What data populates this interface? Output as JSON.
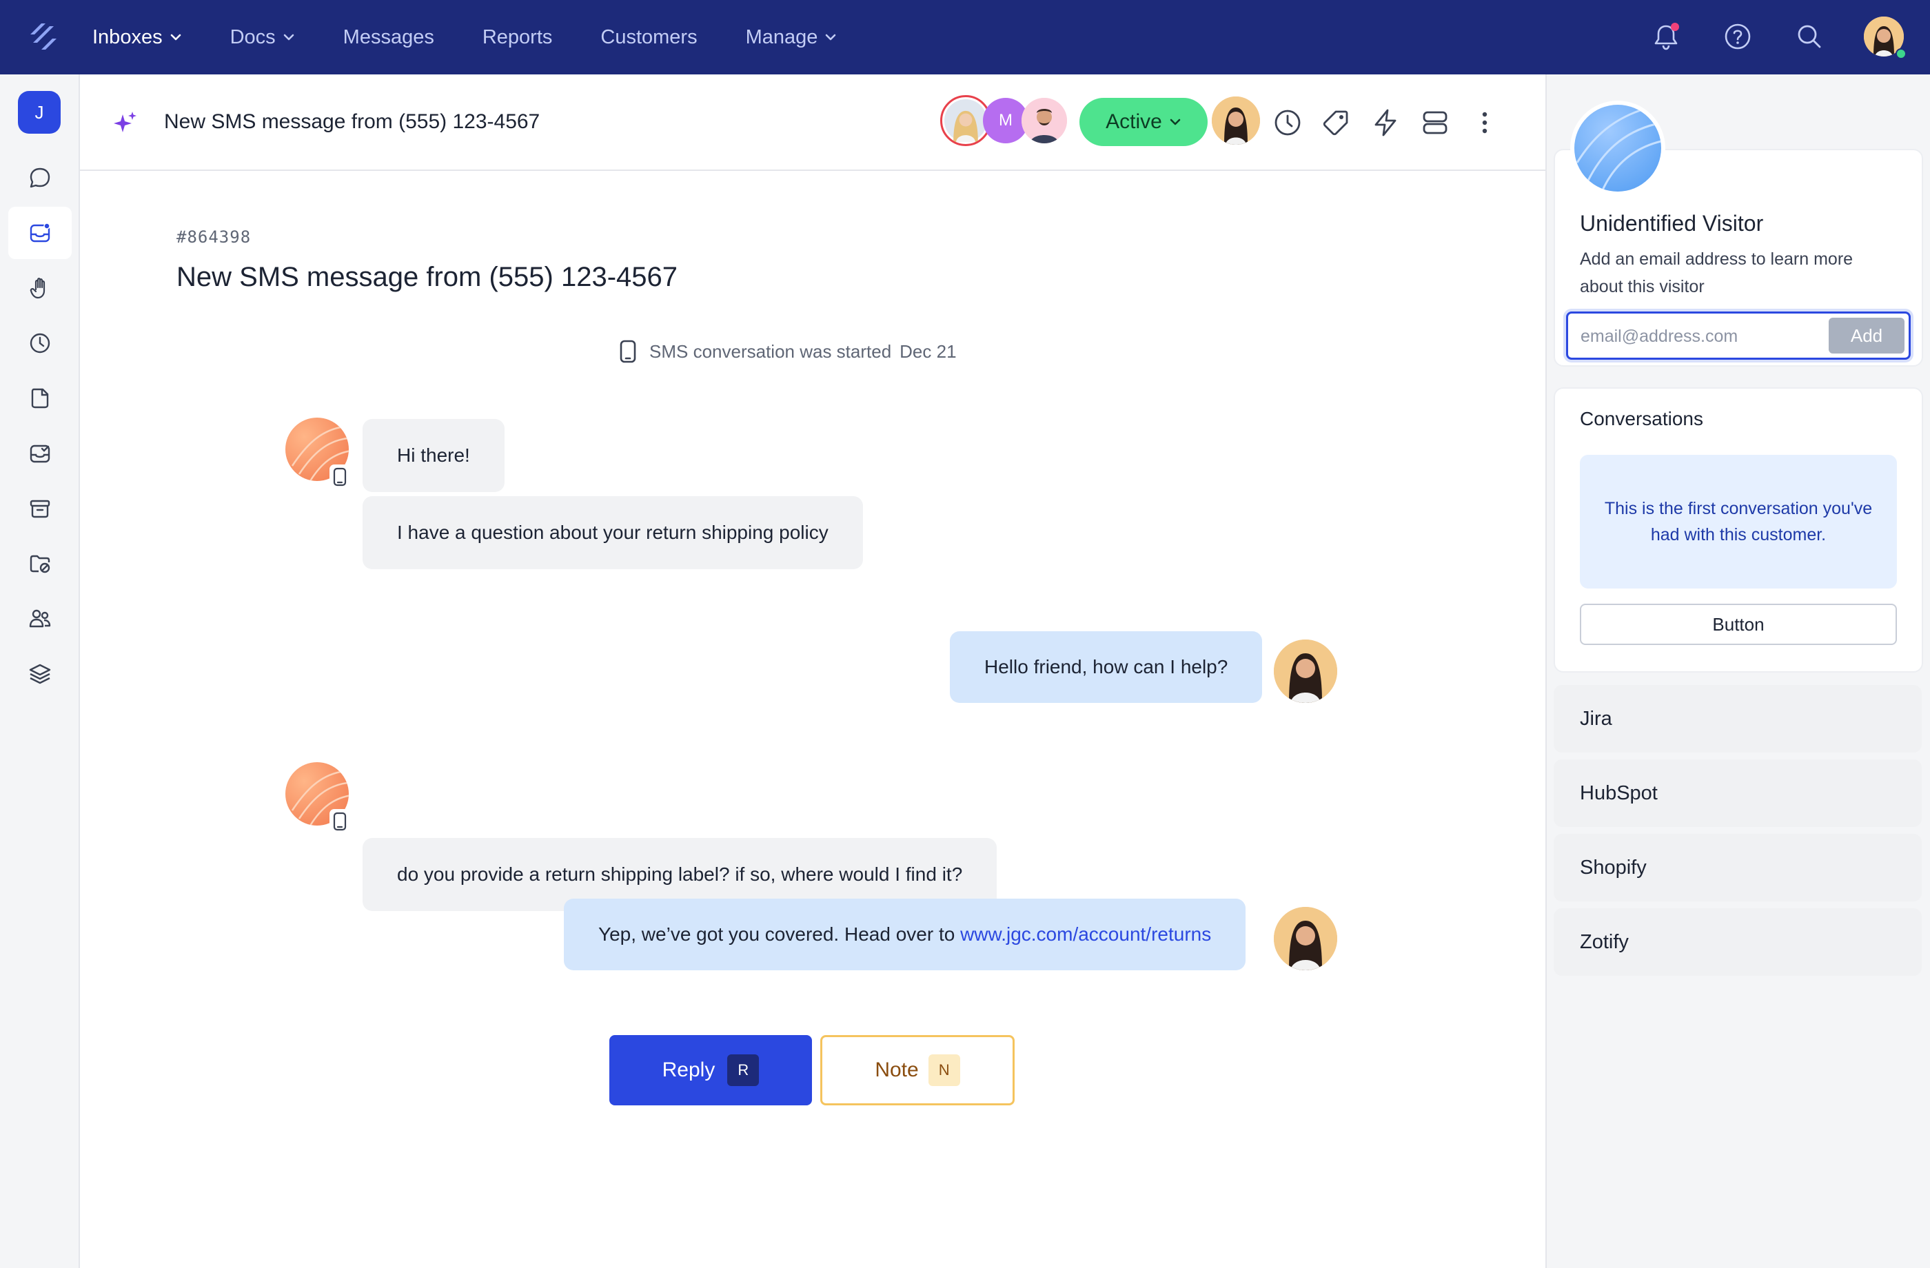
{
  "nav": {
    "items": [
      {
        "label": "Inboxes",
        "dropdown": true,
        "active": true
      },
      {
        "label": "Docs",
        "dropdown": true,
        "active": false
      },
      {
        "label": "Messages",
        "dropdown": false,
        "active": false
      },
      {
        "label": "Reports",
        "dropdown": false,
        "active": false
      },
      {
        "label": "Customers",
        "dropdown": false,
        "active": false
      },
      {
        "label": "Manage",
        "dropdown": true,
        "active": false
      }
    ],
    "icons": [
      "bell-icon",
      "help-icon",
      "search-icon"
    ],
    "has_notification": true,
    "user_online": true
  },
  "sidebar": {
    "workspace_initial": "J",
    "items": [
      "chat-bubble-icon",
      "inbox-icon",
      "hand-icon",
      "clock-icon",
      "document-icon",
      "inbox-check-icon",
      "archive-icon",
      "folder-block-icon",
      "users-icon",
      "layers-icon"
    ],
    "active_index": 1
  },
  "conversation": {
    "header_title": "New SMS message from (555) 123-4567",
    "status": "Active",
    "id": "#864398",
    "title": "New SMS message from (555) 123-4567",
    "started_text": "SMS conversation was started",
    "started_date": "Dec 21",
    "messages": {
      "m1": "Hi there!",
      "m2": "I have a question about your return shipping policy",
      "m3": "Hello friend, how can I help?",
      "m4": "do you provide a return shipping label? if so, where would I find it?",
      "m5_text": "Yep, we’ve got you covered. Head over to",
      "m5_link": "www.jgc.com/account/returns"
    },
    "reply_label": "Reply",
    "reply_key": "R",
    "note_label": "Note",
    "note_key": "N",
    "participant_initial": "M"
  },
  "visitor": {
    "name": "Unidentified Visitor",
    "description": "Add an email address to learn more about this visitor",
    "email_placeholder": "email@address.com",
    "add_label": "Add"
  },
  "conversations_card": {
    "title": "Conversations",
    "message": "This is the first conversation you've had with this customer.",
    "button_label": "Button"
  },
  "integrations": [
    "Jira",
    "HubSpot",
    "Shopify",
    "Zotify"
  ],
  "colors": {
    "nav_bg": "#1d2a7a",
    "accent": "#2b48e0",
    "status_active": "#4ee38e",
    "outgoing_bubble": "#d4e6fc",
    "incoming_bubble": "#f1f2f4",
    "note_border": "#f5c45e"
  }
}
